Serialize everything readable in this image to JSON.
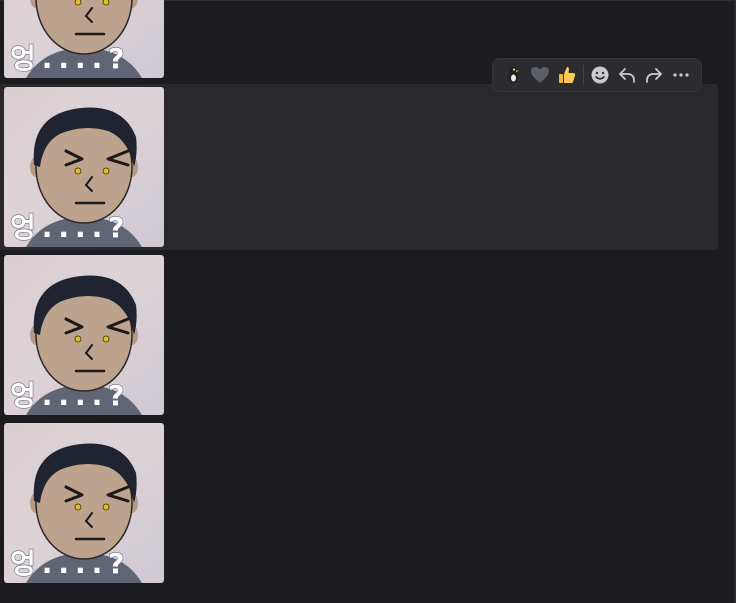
{
  "chat": {
    "messages": [
      {
        "type": "sticker",
        "caption": "엉....?",
        "state": "partial-top"
      },
      {
        "type": "sticker",
        "caption": "엉....?",
        "state": "hovered"
      },
      {
        "type": "sticker",
        "caption": "엉....?",
        "state": "normal"
      },
      {
        "type": "sticker",
        "caption": "엉....?",
        "state": "normal"
      }
    ]
  },
  "hover_toolbar": {
    "quick_reactions": [
      "bird-emoji",
      "heart-emoji",
      "thumbs-up-emoji"
    ],
    "actions": [
      "add-reaction",
      "reply",
      "forward",
      "more-options"
    ]
  },
  "colors": {
    "background": "#1c1b20",
    "hover_row": "#29292d",
    "toolbar_bg": "#2b2b30",
    "icon": "#c9c9cf"
  }
}
